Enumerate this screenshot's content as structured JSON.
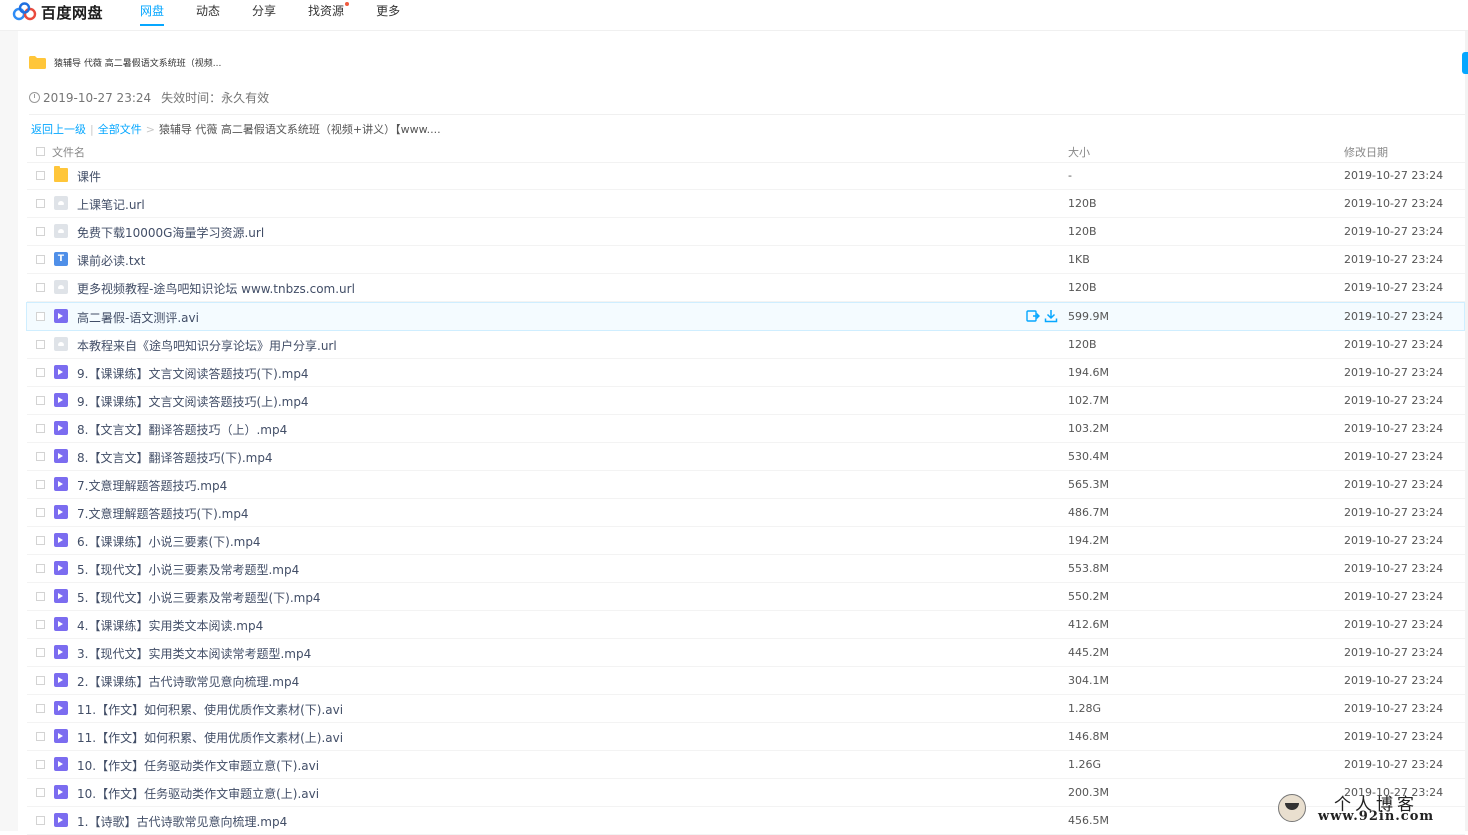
{
  "brand": {
    "name": "百度网盘"
  },
  "nav": [
    {
      "label": "网盘",
      "active": true
    },
    {
      "label": "动态"
    },
    {
      "label": "分享"
    },
    {
      "label": "找资源",
      "dot": true
    },
    {
      "label": "更多"
    }
  ],
  "share": {
    "title": "猿辅导 代薇 高二暑假语文系统班（视频...",
    "created": "2019-10-27 23:24",
    "expire_label": "失效时间：",
    "expire_value": "永久有效"
  },
  "breadcrumb": {
    "back": "返回上一级",
    "all": "全部文件",
    "current": "猿辅导 代薇 高二暑假语文系统班（视频+讲义）【www...."
  },
  "table": {
    "headers": {
      "name": "文件名",
      "size": "大小",
      "date": "修改日期"
    },
    "rows": [
      {
        "type": "folder",
        "name": "课件",
        "size": "-",
        "date": "2019-10-27 23:24"
      },
      {
        "type": "url",
        "name": "上课笔记.url",
        "size": "120B",
        "date": "2019-10-27 23:24"
      },
      {
        "type": "url",
        "name": "免费下载10000G海量学习资源.url",
        "size": "120B",
        "date": "2019-10-27 23:24"
      },
      {
        "type": "txt",
        "name": "课前必读.txt",
        "size": "1KB",
        "date": "2019-10-27 23:24"
      },
      {
        "type": "url",
        "name": "更多视频教程-途鸟吧知识论坛 www.tnbzs.com.url",
        "size": "120B",
        "date": "2019-10-27 23:24"
      },
      {
        "type": "video",
        "name": "高二暑假-语文测评.avi",
        "size": "599.9M",
        "date": "2019-10-27 23:24",
        "hover": true
      },
      {
        "type": "url",
        "name": "本教程来自《途鸟吧知识分享论坛》用户分享.url",
        "size": "120B",
        "date": "2019-10-27 23:24"
      },
      {
        "type": "video",
        "name": "9.【课课练】文言文阅读答题技巧(下).mp4",
        "size": "194.6M",
        "date": "2019-10-27 23:24"
      },
      {
        "type": "video",
        "name": "9.【课课练】文言文阅读答题技巧(上).mp4",
        "size": "102.7M",
        "date": "2019-10-27 23:24"
      },
      {
        "type": "video",
        "name": "8.【文言文】翻译答题技巧（上）.mp4",
        "size": "103.2M",
        "date": "2019-10-27 23:24"
      },
      {
        "type": "video",
        "name": "8.【文言文】翻译答题技巧(下).mp4",
        "size": "530.4M",
        "date": "2019-10-27 23:24"
      },
      {
        "type": "video",
        "name": "7.文意理解题答题技巧.mp4",
        "size": "565.3M",
        "date": "2019-10-27 23:24"
      },
      {
        "type": "video",
        "name": "7.文意理解题答题技巧(下).mp4",
        "size": "486.7M",
        "date": "2019-10-27 23:24"
      },
      {
        "type": "video",
        "name": "6.【课课练】小说三要素(下).mp4",
        "size": "194.2M",
        "date": "2019-10-27 23:24"
      },
      {
        "type": "video",
        "name": "5.【现代文】小说三要素及常考题型.mp4",
        "size": "553.8M",
        "date": "2019-10-27 23:24"
      },
      {
        "type": "video",
        "name": "5.【现代文】小说三要素及常考题型(下).mp4",
        "size": "550.2M",
        "date": "2019-10-27 23:24"
      },
      {
        "type": "video",
        "name": "4.【课课练】实用类文本阅读.mp4",
        "size": "412.6M",
        "date": "2019-10-27 23:24"
      },
      {
        "type": "video",
        "name": "3.【现代文】实用类文本阅读常考题型.mp4",
        "size": "445.2M",
        "date": "2019-10-27 23:24"
      },
      {
        "type": "video",
        "name": "2.【课课练】古代诗歌常见意向梳理.mp4",
        "size": "304.1M",
        "date": "2019-10-27 23:24"
      },
      {
        "type": "video",
        "name": "11.【作文】如何积累、使用优质作文素材(下).avi",
        "size": "1.28G",
        "date": "2019-10-27 23:24"
      },
      {
        "type": "video",
        "name": "11.【作文】如何积累、使用优质作文素材(上).avi",
        "size": "146.8M",
        "date": "2019-10-27 23:24"
      },
      {
        "type": "video",
        "name": "10.【作文】任务驱动类作文审题立意(下).avi",
        "size": "1.26G",
        "date": "2019-10-27 23:24"
      },
      {
        "type": "video",
        "name": "10.【作文】任务驱动类作文审题立意(上).avi",
        "size": "200.3M",
        "date": "2019-10-27 23:24"
      },
      {
        "type": "video",
        "name": "1.【诗歌】古代诗歌常见意向梳理.mp4",
        "size": "456.5M",
        "date": ""
      }
    ]
  },
  "watermark": {
    "line1": "个人博客",
    "line2": "www.92in.com"
  },
  "colors": {
    "accent": "#06a7ff",
    "video": "#7b6cf0",
    "folder": "#ffc63a"
  }
}
